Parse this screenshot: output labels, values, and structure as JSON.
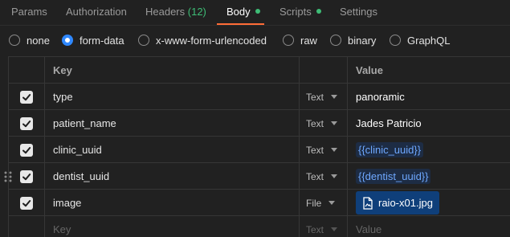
{
  "tabs": [
    {
      "label": "Params"
    },
    {
      "label": "Authorization"
    },
    {
      "label": "Headers",
      "count": "(12)"
    },
    {
      "label": "Body"
    },
    {
      "label": "Scripts"
    },
    {
      "label": "Settings"
    }
  ],
  "body_types": [
    {
      "label": "none",
      "selected": false
    },
    {
      "label": "form-data",
      "selected": true
    },
    {
      "label": "x-www-form-urlencoded",
      "selected": false
    },
    {
      "label": "raw",
      "selected": false
    },
    {
      "label": "binary",
      "selected": false
    },
    {
      "label": "GraphQL",
      "selected": false
    }
  ],
  "table": {
    "headers": {
      "key": "Key",
      "value": "Value"
    },
    "rows": [
      {
        "key": "type",
        "type": "Text",
        "value": "panoramic",
        "checked": true
      },
      {
        "key": "patient_name",
        "type": "Text",
        "value": "Jades Patricio",
        "checked": true
      },
      {
        "key": "clinic_uuid",
        "type": "Text",
        "value": "{{clinic_uuid}}",
        "checked": true
      },
      {
        "key": "dentist_uuid",
        "type": "Text",
        "value": "{{dentist_uuid}}",
        "checked": true
      },
      {
        "key": "image",
        "type": "File",
        "value": "raio-x01.jpg",
        "checked": true
      }
    ],
    "placeholder": {
      "key": "Key",
      "type": "Text",
      "value": "Value"
    }
  },
  "colors": {
    "accent": "#ff6c37",
    "status_dot": "#3ebd76",
    "radio_selected": "#2f88ff",
    "variable": "#6ea8ff",
    "file_chip": "#0f3f7a"
  }
}
